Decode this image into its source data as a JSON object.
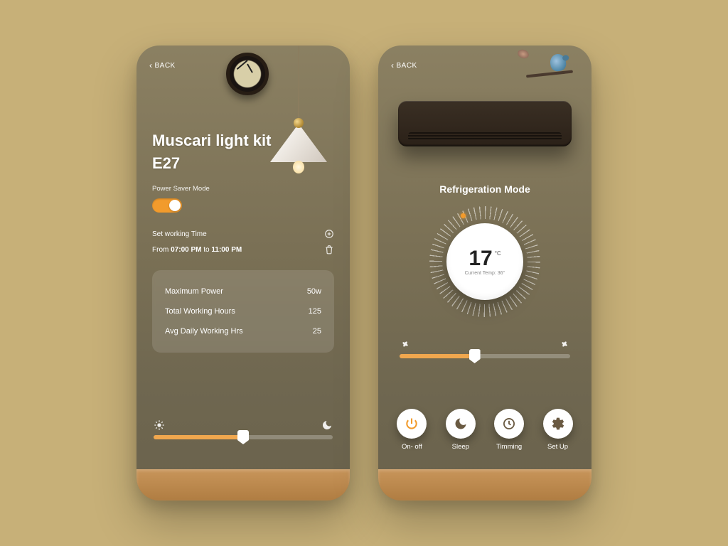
{
  "colors": {
    "accent": "#F29B2C",
    "background": "#C7B078"
  },
  "left": {
    "back": "BACK",
    "title": "Muscari light kit E27",
    "psm_label": "Power Saver Mode",
    "psm_on": true,
    "swt": {
      "label": "Set working Time",
      "prefix": "From",
      "from": "07:00 PM",
      "mid": "to",
      "to": "11:00 PM"
    },
    "stats": [
      {
        "label": "Maximum Power",
        "value": "50w"
      },
      {
        "label": "Total Working Hours",
        "value": "125"
      },
      {
        "label": "Avg Daily Working Hrs",
        "value": "25"
      }
    ],
    "slider_percent": 50
  },
  "right": {
    "back": "BACK",
    "mode_title": "Refrigeration Mode",
    "temp_value": "17",
    "temp_unit": "°C",
    "current_label": "Current Temp: 36°",
    "slider_percent": 44,
    "modes": [
      {
        "id": "power",
        "label": "On- off",
        "active": true,
        "icon": "power"
      },
      {
        "id": "sleep",
        "label": "Sleep",
        "active": false,
        "icon": "moon"
      },
      {
        "id": "time",
        "label": "Timming",
        "active": false,
        "icon": "clock"
      },
      {
        "id": "setup",
        "label": "Set Up",
        "active": false,
        "icon": "gear"
      }
    ]
  }
}
